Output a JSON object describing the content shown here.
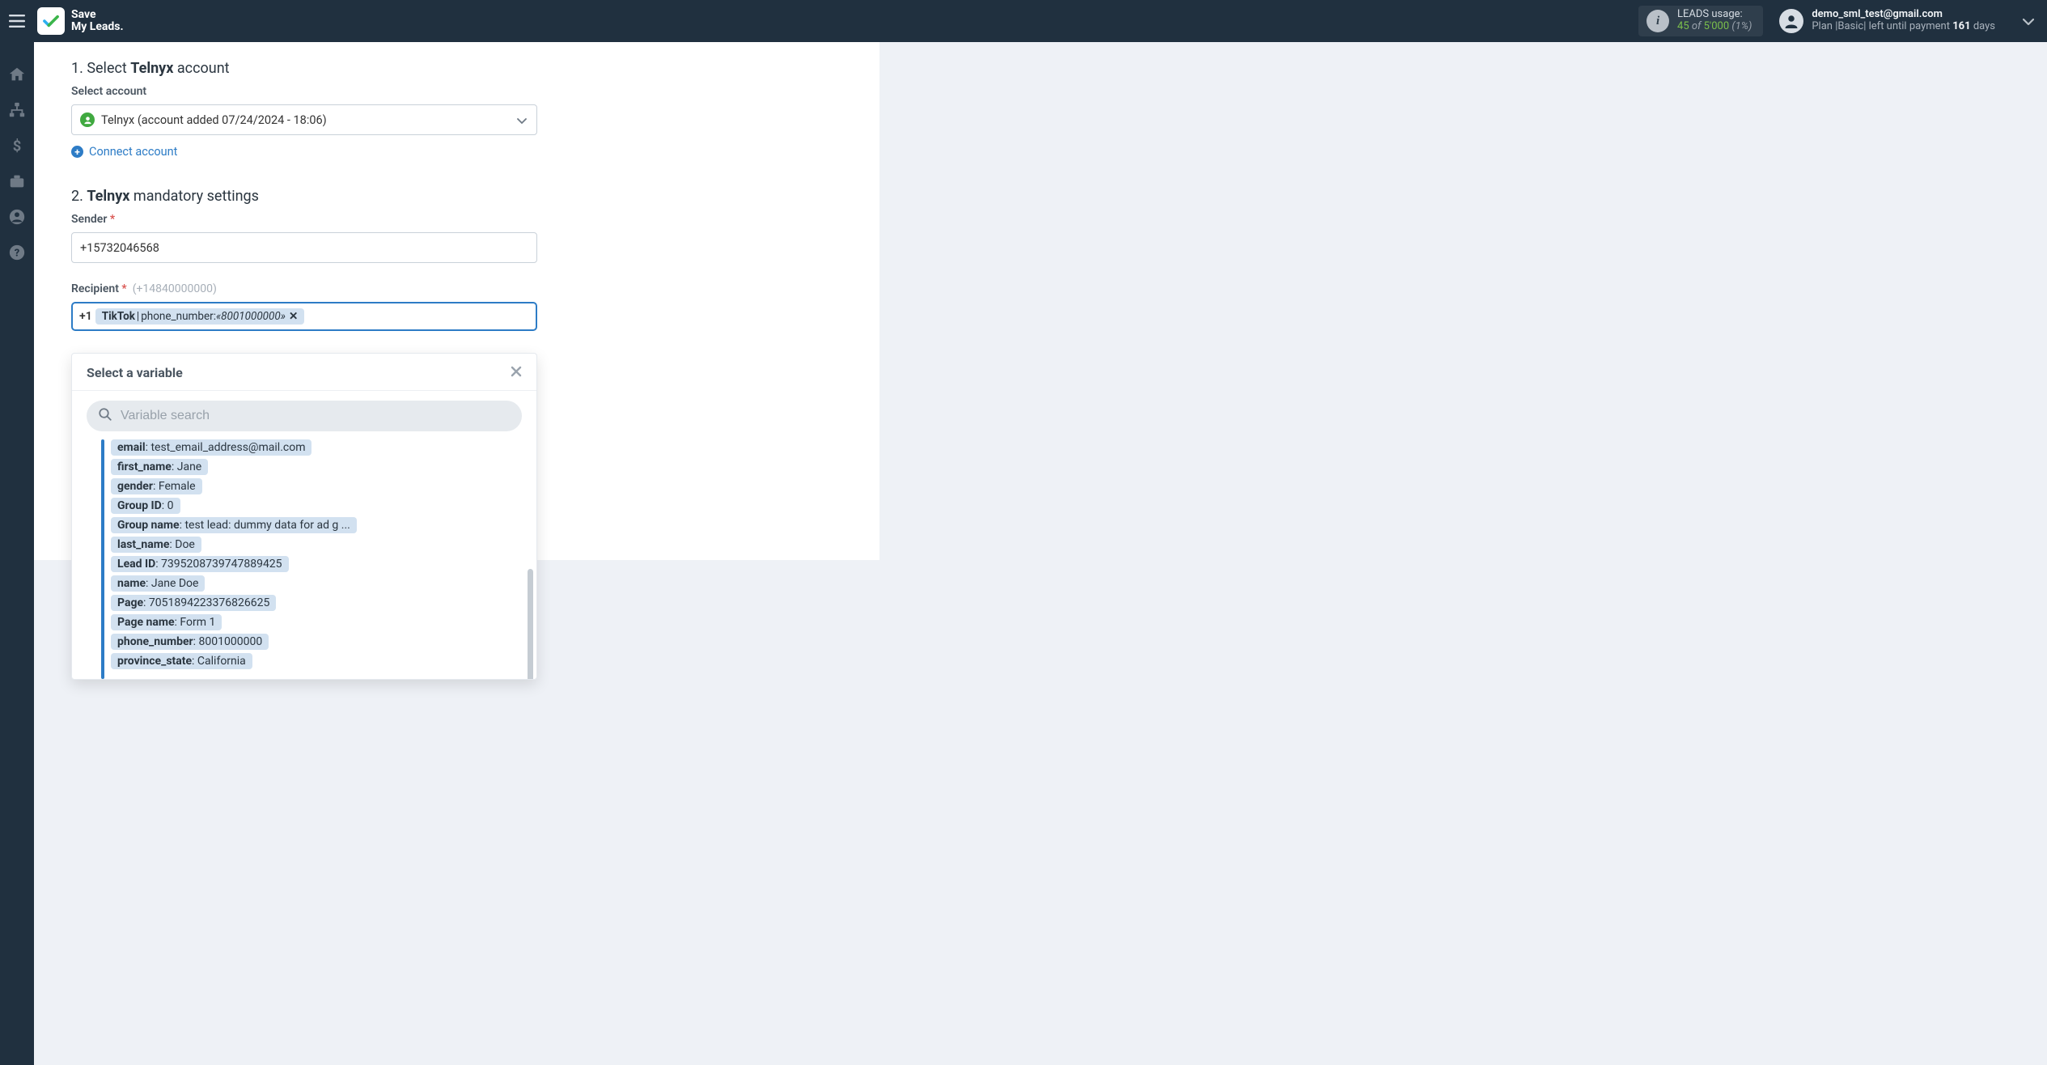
{
  "header": {
    "logo_line1": "Save",
    "logo_line2": "My Leads.",
    "leads_label": "LEADS usage:",
    "leads_used": "45",
    "leads_of": " of ",
    "leads_total": "5'000",
    "leads_pct": " (1%)",
    "user_email": "demo_sml_test@gmail.com",
    "user_plan_prefix": "Plan |Basic| left until payment ",
    "user_plan_days": "161",
    "user_plan_suffix": " days"
  },
  "section1": {
    "title_num": "1. ",
    "title_prefix": "Select ",
    "title_brand": "Telnyx",
    "title_suffix": " account",
    "label_select_account": "Select account",
    "selected_account": "Telnyx (account added 07/24/2024 - 18:06)",
    "connect_account": "Connect account"
  },
  "section2": {
    "title_num": "2. ",
    "title_brand": "Telnyx",
    "title_suffix": " mandatory settings",
    "label_sender": "Sender ",
    "sender_value": "+15732046568",
    "label_recipient": "Recipient ",
    "recipient_hint": "(+14840000000)",
    "recipient_prefix": "+1",
    "chip_brand": "TikTok",
    "chip_sep": " | ",
    "chip_key": "phone_number: ",
    "chip_val": "«8001000000»",
    "chip_x": "✕"
  },
  "required": "*",
  "dropdown": {
    "title": "Select a variable",
    "search_placeholder": "Variable search",
    "variables": [
      {
        "k": "email",
        "v": ": test_email_address@mail.com"
      },
      {
        "k": "first_name",
        "v": ": Jane"
      },
      {
        "k": "gender",
        "v": ": Female"
      },
      {
        "k": "Group ID",
        "v": ": 0"
      },
      {
        "k": "Group name",
        "v": ": test lead: dummy data for ad g ..."
      },
      {
        "k": "last_name",
        "v": ": Doe"
      },
      {
        "k": "Lead ID",
        "v": ": 7395208739747889425"
      },
      {
        "k": "name",
        "v": ": Jane Doe"
      },
      {
        "k": "Page",
        "v": ": 7051894223376826625"
      },
      {
        "k": "Page name",
        "v": ": Form 1"
      },
      {
        "k": "phone_number",
        "v": ": 8001000000"
      },
      {
        "k": "province_state",
        "v": ": California"
      }
    ]
  }
}
